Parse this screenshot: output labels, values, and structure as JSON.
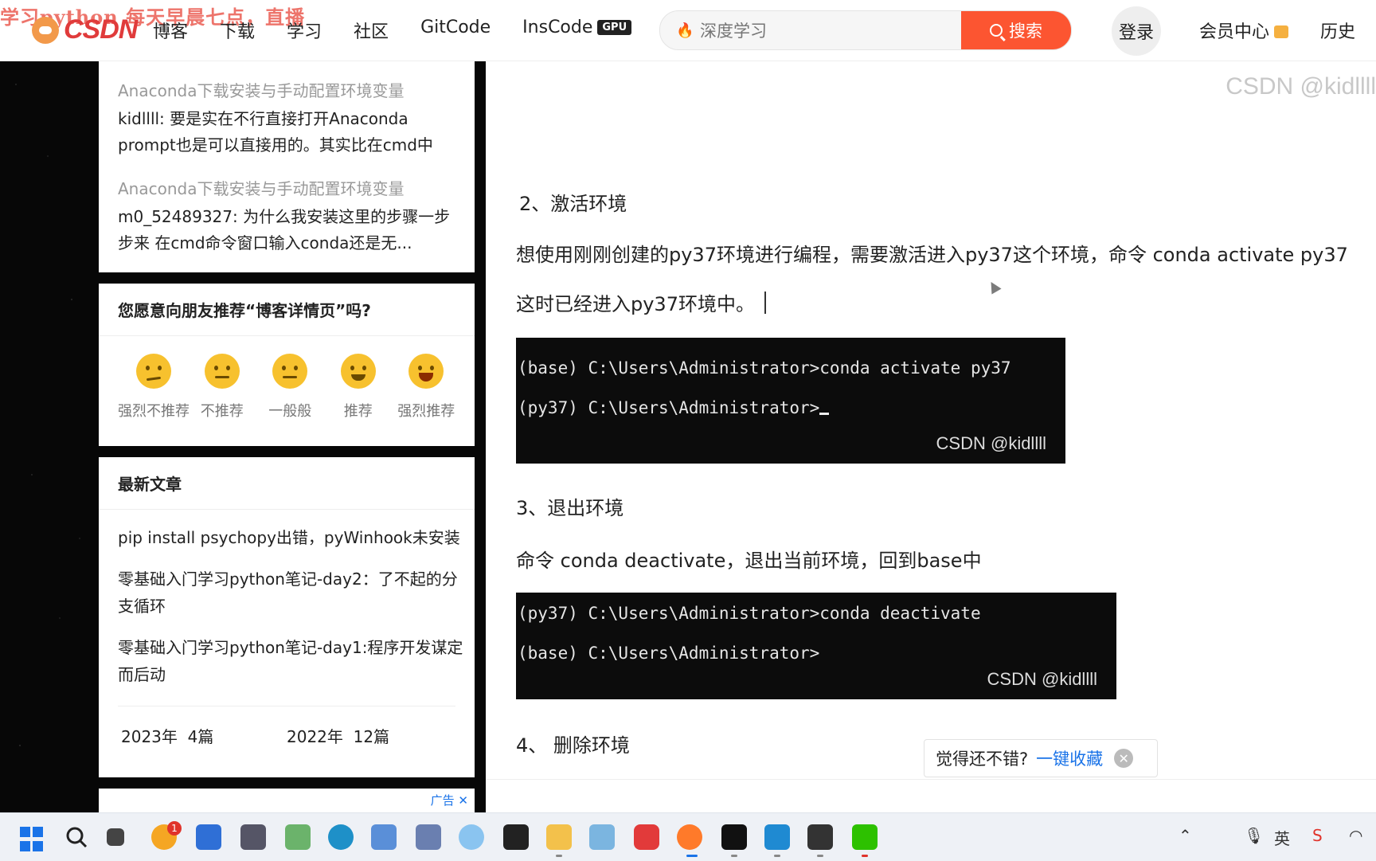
{
  "topbar": {
    "watermark": "学习python 每天早晨七点，直播",
    "logo": "CSDN",
    "nav": [
      "博客",
      "下载",
      "学习",
      "社区",
      "GitCode",
      "InsCode"
    ],
    "gpu_badge": "GPU",
    "search": {
      "placeholder": "深度学习",
      "button": "搜索"
    },
    "login": "登录",
    "vip": "会员中心",
    "history": "历史"
  },
  "sidebar": {
    "comments": [
      {
        "title": "Anaconda下载安装与手动配置环境变量",
        "body": "kidllll: 要是实在不行直接打开Anaconda prompt也是可以直接用的。其实比在cmd中打..."
      },
      {
        "title": "Anaconda下载安装与手动配置环境变量",
        "body": "m0_52489327: 为什么我安装这里的步骤一步步来 在cmd命令窗口输入conda还是无..."
      }
    ],
    "recommend": {
      "title": "您愿意向朋友推荐“博客详情页”吗?",
      "options": [
        "强烈不推荐",
        "不推荐",
        "一般般",
        "推荐",
        "强烈推荐"
      ]
    },
    "articles": {
      "title": "最新文章",
      "items": [
        "pip install psychopy出错，pyWinhook未安装",
        "零基础入门学习python笔记-day2：了不起的分支循环",
        "零基础入门学习python笔记-day1:程序开发谋定而后动"
      ],
      "archive": [
        {
          "year": "2023年",
          "count": "4篇"
        },
        {
          "year": "2022年",
          "count": "12篇"
        }
      ]
    },
    "ad_label": "广告"
  },
  "article": {
    "watermark": "CSDN @kidllll",
    "section2_title": "2、激活环境",
    "section2_para1": "想使用刚刚创建的py37环境进行编程，需要激活进入py37这个环境，命令 conda activate py37",
    "section2_para2": "这时已经进入py37环境中。",
    "term1": {
      "line1": "(base) C:\\Users\\Administrator>conda activate py37",
      "line2": "(py37) C:\\Users\\Administrator>",
      "wm": "CSDN @kidllll"
    },
    "section3_title": "3、退出环境",
    "section3_para": "命令 conda deactivate，退出当前环境，回到base中",
    "term2": {
      "line1": "(py37) C:\\Users\\Administrator>conda deactivate",
      "line2": "(base) C:\\Users\\Administrator>",
      "wm": "CSDN @kidllll"
    },
    "section4_title": "4、 删除环境"
  },
  "toast": {
    "text": "觉得还不错?",
    "link": "一键收藏"
  },
  "taskbar": {
    "notification_count": "1",
    "ime": "英",
    "accent": "#1a73e8",
    "icons": [
      "windows-start-icon",
      "search-icon",
      "task-view-icon",
      "browser-orange-icon",
      "store-icon",
      "camera-icon",
      "map-icon",
      "edge-icon",
      "chart-icon",
      "tools-icon",
      "puzzle-icon",
      "notes-icon",
      "folder-icon",
      "game-icon",
      "netease-music-icon",
      "firefox-icon",
      "terminal-icon",
      "vscode-icon",
      "console-icon",
      "wechat-icon"
    ]
  }
}
